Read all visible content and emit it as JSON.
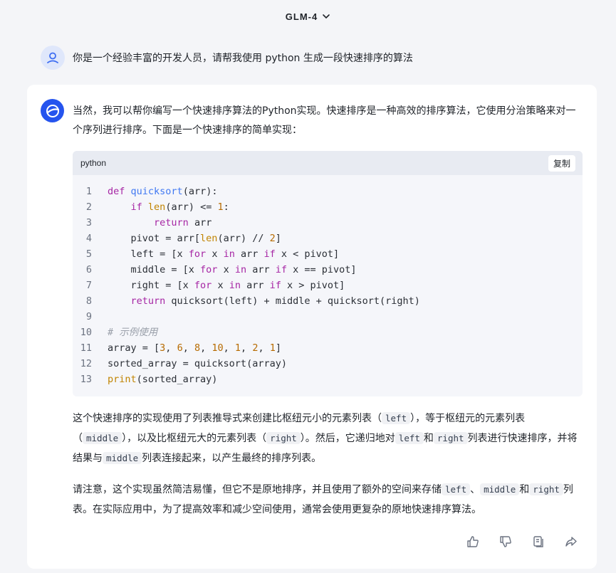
{
  "header": {
    "model_name": "GLM-4"
  },
  "user_message": {
    "text": "你是一个经验丰富的开发人员，请帮我使用 python 生成一段快速排序的算法"
  },
  "answer": {
    "intro": "当然，我可以帮你编写一个快速排序算法的Python实现。快速排序是一种高效的排序算法，它使用分治策略来对一个序列进行排序。下面是一个快速排序的简单实现：",
    "code_block": {
      "language": "python",
      "copy_label": "复制",
      "line_numbers": [
        "1",
        "2",
        "3",
        "4",
        "5",
        "6",
        "7",
        "8",
        "9",
        "10",
        "11",
        "12",
        "13"
      ],
      "lines": [
        "def quicksort(arr):",
        "    if len(arr) <= 1:",
        "        return arr",
        "    pivot = arr[len(arr) // 2]",
        "    left = [x for x in arr if x < pivot]",
        "    middle = [x for x in arr if x == pivot]",
        "    right = [x for x in arr if x > pivot]",
        "    return quicksort(left) + middle + quicksort(right)",
        "",
        "# 示例使用",
        "array = [3, 6, 8, 10, 1, 2, 1]",
        "sorted_array = quicksort(array)",
        "print(sorted_array)"
      ]
    },
    "para1": {
      "t1": "这个快速排序的实现使用了列表推导式来创建比枢纽元小的元素列表（",
      "c1": "left",
      "t2": "），等于枢纽元的元素列表（",
      "c2": "middle",
      "t3": "），以及比枢纽元大的元素列表（",
      "c3": "right",
      "t4": "）。然后，它递归地对",
      "c4": "left",
      "t5": "和",
      "c5": "right",
      "t6": "列表进行快速排序，并将结果与",
      "c6": "middle",
      "t7": "列表连接起来，以产生最终的排序列表。"
    },
    "para2": {
      "t1": "请注意，这个实现虽然简洁易懂，但它不是原地排序，并且使用了额外的空间来存储",
      "c1": "left",
      "t2": "、",
      "c2": "middle",
      "t3": "和",
      "c3": "right",
      "t4": "列表。在实际应用中，为了提高效率和减少空间使用，通常会使用更复杂的原地快速排序算法。"
    },
    "actions": {
      "icons": [
        "thumbs-up-icon",
        "thumbs-down-icon",
        "copy-icon",
        "share-icon"
      ]
    }
  },
  "colors": {
    "background": "#f4f5f8",
    "accent": "#2554ee",
    "keyword": "#a626a4",
    "function": "#4078f2",
    "number": "#b76b01"
  }
}
